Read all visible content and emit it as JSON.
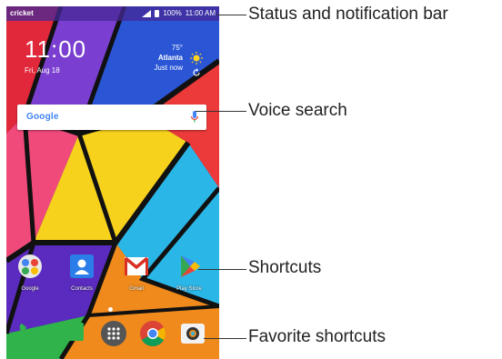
{
  "status_bar": {
    "carrier": "cricket",
    "battery": "100%",
    "time": "11:00 AM"
  },
  "clock": {
    "time": "11:00",
    "date": "Fri, Aug 18"
  },
  "weather": {
    "temp": "75°",
    "city": "Atlanta",
    "updated": "Just now"
  },
  "search": {
    "logo": "Google"
  },
  "shortcuts": [
    {
      "label": "Google"
    },
    {
      "label": "Contacts"
    },
    {
      "label": "Gmail"
    },
    {
      "label": "Play Store"
    }
  ],
  "callouts": {
    "status": "Status and notification bar",
    "voice": "Voice search",
    "shortcuts": "Shortcuts",
    "favorites": "Favorite shortcuts"
  },
  "colors": {
    "status_bar": "#4628a0",
    "accent_green": "#2fb34a"
  }
}
